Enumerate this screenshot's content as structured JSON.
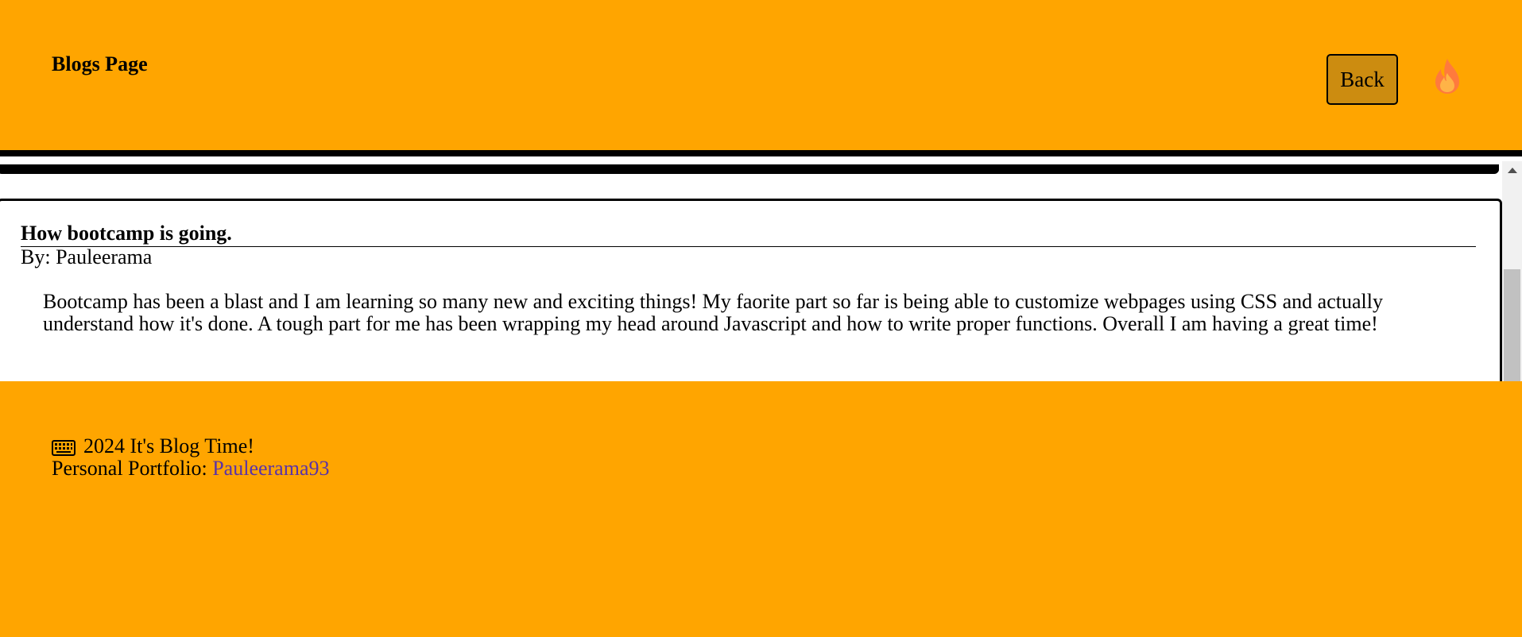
{
  "header": {
    "title": "Blogs Page",
    "back_label": "Back",
    "theme_icon": "flame-icon"
  },
  "blog": {
    "title": "How bootcamp is going.",
    "author": "By: Pauleerama",
    "body": "Bootcamp has been a blast and I am learning so many new and exciting things! My faorite part so far is being able to customize webpages using CSS and actually understand how it's done. A tough part for me has been wrapping my head around Javascript and how to write proper functions. Overall I am having a great time!"
  },
  "footer": {
    "copyright": "2024 It's Blog Time!",
    "portfolio_label": "Personal Portfolio:",
    "portfolio_link": "Pauleerama93",
    "copyright_icon": "keyboard-icon"
  },
  "colors": {
    "background": "#ffa500",
    "button": "#cc8c10",
    "link": "#5a33a8",
    "flame_outer": "#ff7a3d",
    "flame_inner": "#ffb347"
  }
}
